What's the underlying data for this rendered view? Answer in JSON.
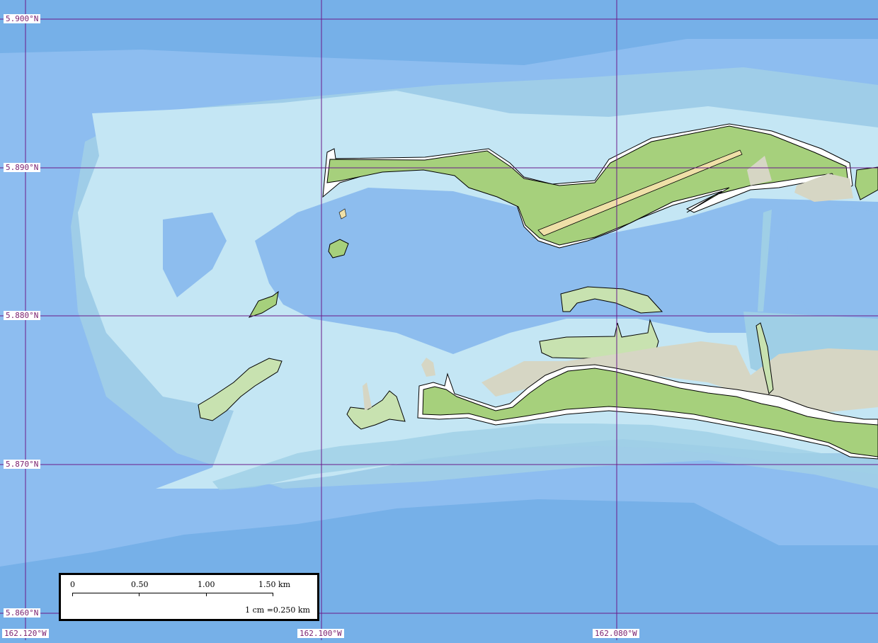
{
  "map": {
    "grid_color": "#6a1a8a",
    "colors": {
      "deep_ocean": "#76b0e8",
      "mid_ocean": "#8dbdf0",
      "lagoon": "#8dbdee",
      "shallow_reef": "#c4e6f4",
      "reef_flat": "#9fcfe6",
      "vegetation": "#a6d07c",
      "light_vegetation": "#c8e2b0",
      "sand_flat": "#d6d6c4",
      "beach": "#ffffff",
      "runway": "#efe0a8"
    }
  },
  "latitude_labels": [
    "5.900°N",
    "5.890°N",
    "5.880°N",
    "5.870°N",
    "5.860°N"
  ],
  "longitude_labels": [
    "162.120°W",
    "162.100°W",
    "162.080°W"
  ],
  "scale_bar": {
    "ticks": [
      "0",
      "0.50",
      "1.00",
      "1.50 km"
    ],
    "ratio": "1 cm =0.250 km"
  }
}
